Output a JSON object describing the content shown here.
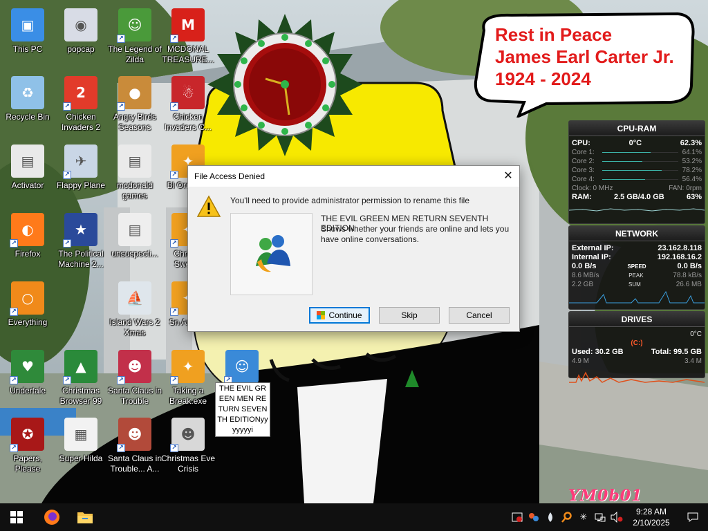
{
  "desktop_icons": [
    {
      "id": "this-pc",
      "label": "This PC",
      "icon": "computer-icon",
      "color": "#3a8ee6",
      "shortcut": false
    },
    {
      "id": "popcap",
      "label": "popcap",
      "icon": "popcap-icon",
      "color": "#d8dce6",
      "shortcut": false
    },
    {
      "id": "legend-of-zilda",
      "label": "The Legend of Zilda",
      "icon": "zilda-icon",
      "color": "#4a9a3a",
      "shortcut": true
    },
    {
      "id": "mcdonald-treasure",
      "label": "MCDONAL TREASURE...",
      "icon": "mcdonalds-icon",
      "color": "#d8211a",
      "shortcut": true
    },
    {
      "id": "recycle-bin",
      "label": "Recycle Bin",
      "icon": "recycle-bin-icon",
      "color": "#8fc1e8",
      "shortcut": false
    },
    {
      "id": "chicken-invaders-2",
      "label": "Chicken Invaders 2",
      "icon": "chicken-icon",
      "color": "#e23b2a",
      "shortcut": true
    },
    {
      "id": "angry-birds-seasons",
      "label": "Angry Birds Seasons",
      "icon": "angry-birds-icon",
      "color": "#c98b3a",
      "shortcut": true
    },
    {
      "id": "chicken-invaders-c",
      "label": "Chicken Invaders C...",
      "icon": "chicken-xmas-icon",
      "color": "#c8262b",
      "shortcut": true
    },
    {
      "id": "activator",
      "label": "Activator",
      "icon": "file-icon",
      "color": "#e9e9e9",
      "shortcut": false
    },
    {
      "id": "flappy-plane",
      "label": "Flappy Plane",
      "icon": "flappy-icon",
      "color": "#c9d6e6",
      "shortcut": true
    },
    {
      "id": "mcdonald-games",
      "label": "mcdonald games",
      "icon": "folder-icon",
      "color": "#eaeaea",
      "shortcut": false
    },
    {
      "id": "bl-ornam",
      "label": "Bl Ornam...",
      "icon": "taking-a-break-icon",
      "color": "#f0a020",
      "shortcut": true
    },
    {
      "id": "firefox",
      "label": "Firefox",
      "icon": "firefox-icon",
      "color": "#ff7a1a",
      "shortcut": true
    },
    {
      "id": "political-machine",
      "label": "The Political Machine 2...",
      "icon": "political-machine-icon",
      "color": "#2a4a9a",
      "shortcut": true
    },
    {
      "id": "unsuspecti",
      "label": "unsuspecti...",
      "icon": "file-icon",
      "color": "#eeeeee",
      "shortcut": false
    },
    {
      "id": "christ-swee",
      "label": "Christ... Swee...",
      "icon": "taking-a-break-icon",
      "color": "#f0a020",
      "shortcut": true
    },
    {
      "id": "everything",
      "label": "Everything",
      "icon": "everything-search-icon",
      "color": "#f08a1a",
      "shortcut": true
    },
    {
      "id": "island-wars",
      "label": "Island Wars 2 Xmas",
      "icon": "island-wars-icon",
      "color": "#dfe6ec",
      "shortcut": false
    },
    {
      "id": "sn-anim",
      "label": "Sn Anim...",
      "icon": "taking-a-break-icon",
      "color": "#f0a020",
      "shortcut": true
    },
    {
      "id": "undertale",
      "label": "Undertale",
      "icon": "undertale-icon",
      "color": "#2f8a3a",
      "shortcut": true
    },
    {
      "id": "christmas-browser",
      "label": "Christmas Browser 99",
      "icon": "xmas-tree-icon",
      "color": "#2a8a3a",
      "shortcut": true
    },
    {
      "id": "santa-claus-trouble",
      "label": "Santa Claus in Trouble",
      "icon": "santa-icon",
      "color": "#c2304a",
      "shortcut": true
    },
    {
      "id": "taking-a-break",
      "label": "Taking a Break.exe",
      "icon": "taking-a-break-icon",
      "color": "#f0a020",
      "shortcut": true
    },
    {
      "id": "evil-green-men",
      "label": "",
      "icon": "messenger-icon",
      "color": "#3a8ad8",
      "shortcut": true
    },
    {
      "id": "papers-please",
      "label": "Papers, Please",
      "icon": "papers-please-icon",
      "color": "#a81818",
      "shortcut": true
    },
    {
      "id": "super-hilda",
      "label": "Super Hilda",
      "icon": "super-hilda-icon",
      "color": "#f2f2f2",
      "shortcut": false
    },
    {
      "id": "santa-claus-trouble-a",
      "label": "Santa Claus in Trouble... A...",
      "icon": "santa-icon",
      "color": "#b24a3a",
      "shortcut": true
    },
    {
      "id": "christmas-eve-crisis",
      "label": "Christmas Eve Crisis",
      "icon": "santa-face-icon",
      "color": "#d8d8d8",
      "shortcut": true
    }
  ],
  "renaming_label": "THE EVIL GREEN MEN RETURN SEVENTH EDITIONyyyyyyyi",
  "bubble": {
    "line1": "Rest in Peace",
    "line2": "James Earl Carter Jr.",
    "line3": "1924 - 2024"
  },
  "cpu_gadget": {
    "title": "CPU-RAM",
    "cpu_label": "CPU:",
    "temp": "0°C",
    "cpu_pct": "62.3%",
    "cores": [
      {
        "label": "Core 1:",
        "value": "64.1%",
        "fill": 0.641
      },
      {
        "label": "Core 2:",
        "value": "53.2%",
        "fill": 0.532
      },
      {
        "label": "Core 3:",
        "value": "78.2%",
        "fill": 0.782
      },
      {
        "label": "Core 4:",
        "value": "56.4%",
        "fill": 0.564
      }
    ],
    "clock": "Clock: 0 MHz",
    "fan": "FAN: 0rpm",
    "ram_label": "RAM:",
    "ram_value": "2.5 GB/4.0 GB",
    "ram_pct": "63%"
  },
  "network_gadget": {
    "title": "NETWORK",
    "external_label": "External IP:",
    "external_ip": "23.162.8.118",
    "internal_label": "Internal IP:",
    "internal_ip": "192.168.16.2",
    "speed_down": "0.0 B/s",
    "speed_label": "SPEED",
    "speed_up": "0.0 B/s",
    "peak_down": "8.6 MB/s",
    "peak_label": "PEAK",
    "peak_up": "78.8 kB/s",
    "sum_down": "2.2 GB",
    "sum_label": "SUM",
    "sum_up": "26.6 MB"
  },
  "drives_gadget": {
    "title": "DRIVES",
    "temp": "0°C",
    "drive": "(C:)",
    "used": "Used: 30.2 GB",
    "total": "Total: 99.5 GB",
    "read": "4.9 M",
    "write": "3.4 M"
  },
  "dialog": {
    "title": "File Access Denied",
    "message": "You'll need to provide administrator permission to rename this file",
    "file_name": "THE EVIL GREEN MEN RETURN SEVENTH EDITION",
    "file_desc": "Shows whether your friends are online and lets you have online conversations.",
    "continue": "Continue",
    "skip": "Skip",
    "cancel": "Cancel"
  },
  "taskbar": {
    "time": "9:28 AM",
    "date": "2/10/2025"
  },
  "watermark": "YM0b01",
  "colors": {
    "dialog_accent": "#0078d7",
    "bubble_text": "#e21b1b",
    "taskbar": "#101010"
  }
}
